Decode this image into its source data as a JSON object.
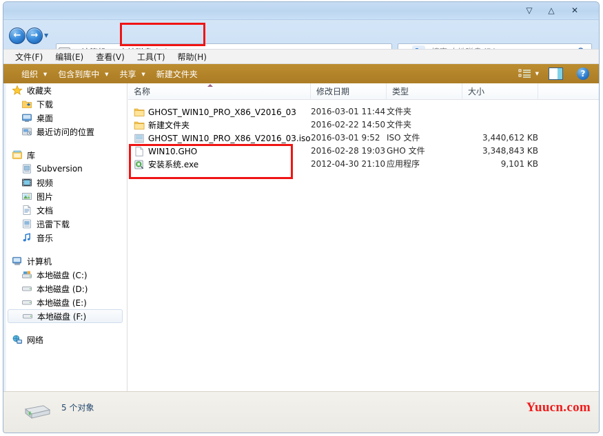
{
  "window": {
    "minimize_label": "▽",
    "maximize_label": "△",
    "close_label": "✕"
  },
  "address_bar": {
    "back_label": "←",
    "forward_label": "→",
    "recent_label": "▼",
    "breadcrumb": [
      {
        "label": "计算机"
      },
      {
        "label": "本地磁盘 (F:)"
      }
    ],
    "separator": "▶",
    "dropdown_label": "▼",
    "refresh_label": "↻",
    "search_placeholder": "搜索 本地磁盘 (F:)",
    "search_value": ""
  },
  "menubar": {
    "items": [
      {
        "label": "文件(F)"
      },
      {
        "label": "编辑(E)"
      },
      {
        "label": "查看(V)"
      },
      {
        "label": "工具(T)"
      },
      {
        "label": "帮助(H)"
      }
    ]
  },
  "toolbar": {
    "items": [
      {
        "label": "组织",
        "caret": "▼"
      },
      {
        "label": "包含到库中",
        "caret": "▼"
      },
      {
        "label": "共享",
        "caret": "▼"
      },
      {
        "label": "新建文件夹",
        "caret": ""
      }
    ],
    "view_caret": "▼",
    "help_label": "?"
  },
  "sidebar": {
    "groups": [
      {
        "header": {
          "label": "收藏夹",
          "icon": "star-icon"
        },
        "items": [
          {
            "label": "下载",
            "icon": "downloads-icon"
          },
          {
            "label": "桌面",
            "icon": "desktop-icon"
          },
          {
            "label": "最近访问的位置",
            "icon": "recent-places-icon"
          }
        ]
      },
      {
        "header": {
          "label": "库",
          "icon": "library-icon"
        },
        "items": [
          {
            "label": "Subversion",
            "icon": "subversion-icon"
          },
          {
            "label": "视频",
            "icon": "video-icon"
          },
          {
            "label": "图片",
            "icon": "pictures-icon"
          },
          {
            "label": "文档",
            "icon": "documents-icon"
          },
          {
            "label": "迅雷下载",
            "icon": "thunder-download-icon"
          },
          {
            "label": "音乐",
            "icon": "music-icon"
          }
        ]
      },
      {
        "header": {
          "label": "计算机",
          "icon": "computer-icon"
        },
        "items": [
          {
            "label": "本地磁盘 (C:)",
            "icon": "system-drive-icon",
            "selected": false
          },
          {
            "label": "本地磁盘 (D:)",
            "icon": "drive-icon",
            "selected": false
          },
          {
            "label": "本地磁盘 (E:)",
            "icon": "drive-icon",
            "selected": false
          },
          {
            "label": "本地磁盘 (F:)",
            "icon": "drive-icon",
            "selected": true
          }
        ]
      },
      {
        "header": {
          "label": "网络",
          "icon": "network-icon"
        },
        "items": []
      }
    ]
  },
  "filelist": {
    "columns": [
      {
        "label": "名称"
      },
      {
        "label": "修改日期"
      },
      {
        "label": "类型"
      },
      {
        "label": "大小"
      }
    ],
    "rows": [
      {
        "name": "GHOST_WIN10_PRO_X86_V2016_03",
        "date": "2016-03-01 11:44",
        "type": "文件夹",
        "size": "",
        "icon": "folder-icon"
      },
      {
        "name": "新建文件夹",
        "date": "2016-02-22 14:50",
        "type": "文件夹",
        "size": "",
        "icon": "folder-icon"
      },
      {
        "name": "GHOST_WIN10_PRO_X86_V2016_03.iso",
        "date": "2016-03-01 9:52",
        "type": "ISO 文件",
        "size": "3,440,612 KB",
        "icon": "iso-file-icon"
      },
      {
        "name": "WIN10.GHO",
        "date": "2016-02-28 19:03",
        "type": "GHO 文件",
        "size": "3,348,843 KB",
        "icon": "generic-file-icon"
      },
      {
        "name": "安装系统.exe",
        "date": "2012-04-30 21:10",
        "type": "应用程序",
        "size": "9,101 KB",
        "icon": "application-icon"
      }
    ]
  },
  "statusbar": {
    "item_count_text": "5 个对象",
    "drive_icon": "drive-icon"
  },
  "watermark": {
    "text": "Yuucn.com"
  },
  "colors": {
    "toolbar": "#b4842a",
    "titlebar": "#bcd6f0",
    "annotation_red": "#f01414",
    "watermark_red": "#ef1c1c",
    "selection_blue": "#cfdced"
  }
}
